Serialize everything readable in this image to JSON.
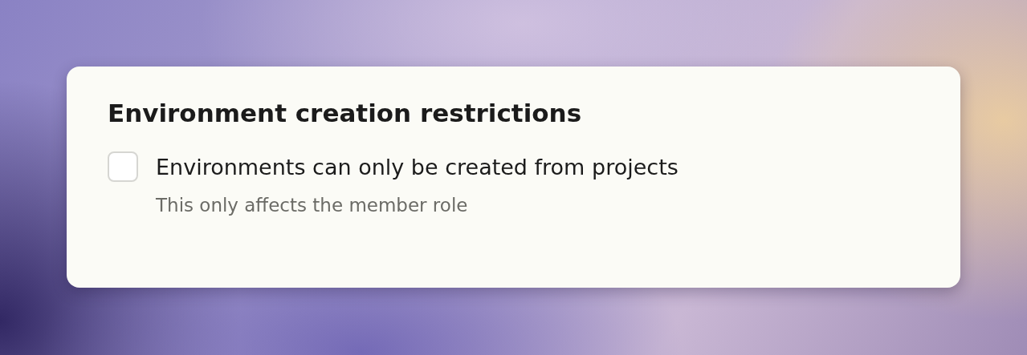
{
  "card": {
    "title": "Environment creation restrictions",
    "option": {
      "label": "Environments can only be created from projects",
      "checked": false,
      "description": "This only affects the member role"
    }
  }
}
